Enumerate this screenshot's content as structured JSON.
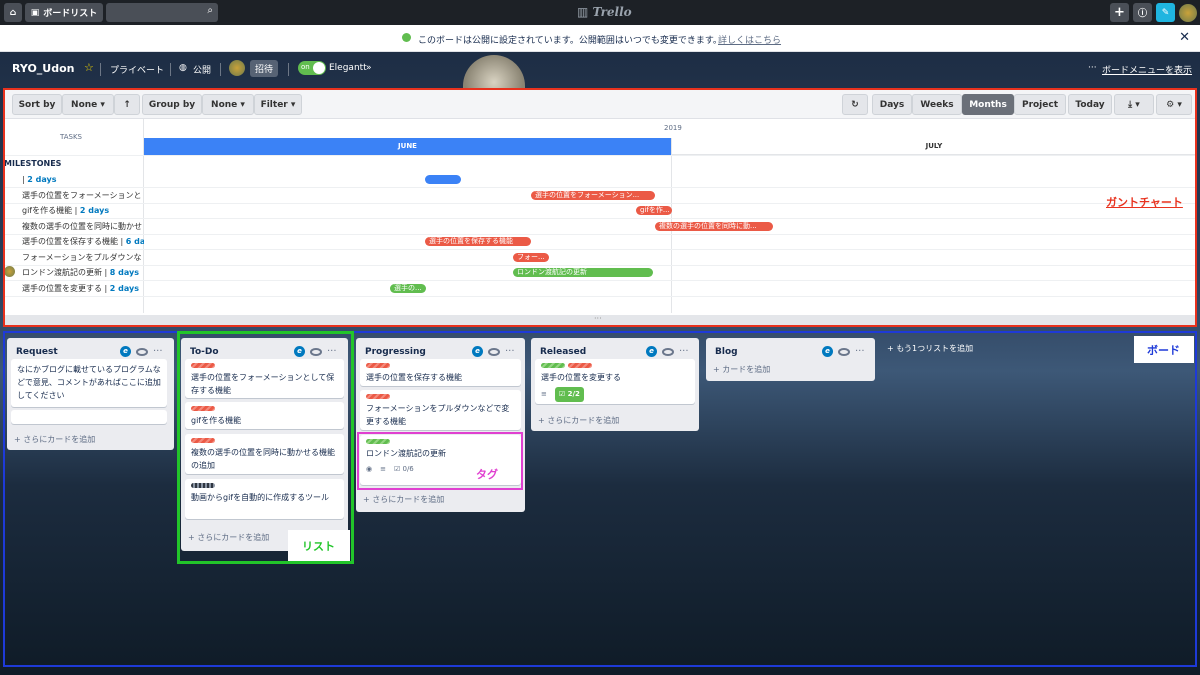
{
  "topbar": {
    "home_icon": "home-icon",
    "boards_button": "ボードリスト",
    "search_icon": "search-icon",
    "logo": "Trello",
    "add_icon": "plus-icon",
    "info_icon": "info-icon",
    "notify_icon": "bell-icon"
  },
  "banner": {
    "message": "このボードは公開に設定されています。公開範囲はいつでも変更できます。",
    "link": "詳しくはこちら",
    "close": "✕"
  },
  "board_header": {
    "title": "RYO_Udon",
    "visibility_private": "プライベート",
    "visibility_public": "公開",
    "invite": "招待",
    "toggle_label": "on",
    "powerup": "Elegantt",
    "menu": "ボードメニューを表示"
  },
  "gantt": {
    "toolbar": {
      "sort_by": "Sort by",
      "sort_none": "None",
      "group_by": "Group by",
      "group_none": "None",
      "filter": "Filter",
      "days": "Days",
      "weeks": "Weeks",
      "months": "Months",
      "project": "Project",
      "today": "Today"
    },
    "tasks_header": "TASKS",
    "year": "2019",
    "month1": "JUNE",
    "month2": "JULY",
    "milestones": "MILESTONES",
    "tasks": [
      {
        "name": "",
        "dur": "2 days"
      },
      {
        "name": "選手の位置をフォーメーションと",
        "dur": ""
      },
      {
        "name": "gifを作る機能 | ",
        "dur": "2 days"
      },
      {
        "name": "複数の選手の位置を同時に動かせ",
        "dur": ""
      },
      {
        "name": "選手の位置を保存する機能 | ",
        "dur": "6 days"
      },
      {
        "name": "フォーメーションをプルダウンな",
        "dur": ""
      },
      {
        "name": "ロンドン渡航記の更新 | ",
        "dur": "8 days"
      },
      {
        "name": "選手の位置を変更する | ",
        "dur": "2 days"
      }
    ],
    "bars": [
      {
        "label": "",
        "color": "blue"
      },
      {
        "label": "選手の位置をフォーメーション...",
        "color": "red"
      },
      {
        "label": "gifを作...",
        "color": "red"
      },
      {
        "label": "複数の選手の位置を同時に動...",
        "color": "red"
      },
      {
        "label": "選手の位置を保存する機能",
        "color": "red"
      },
      {
        "label": "フォー...",
        "color": "red"
      },
      {
        "label": "ロンドン渡航記の更新",
        "color": "green"
      },
      {
        "label": "選手の...",
        "color": "green"
      }
    ]
  },
  "lists": [
    {
      "title": "Request",
      "cards": [
        "なにかブログに載せているプログラムなどで意見、コメントがあればここに追加してください"
      ],
      "add": "+ さらにカードを追加"
    },
    {
      "title": "To-Do",
      "cards": [
        "選手の位置をフォーメーションとして保存する機能",
        "gifを作る機能",
        "複数の選手の位置を同時に動かせる機能の追加",
        "動画からgifを自動的に作成するツール"
      ],
      "add": "+ さらにカードを追加"
    },
    {
      "title": "Progressing",
      "cards": [
        "選手の位置を保存する機能",
        "フォーメーションをプルダウンなどで変更する機能",
        "ロンドン渡航記の更新"
      ],
      "add": "+ さらにカードを追加",
      "checklist": "0/6"
    },
    {
      "title": "Released",
      "cards": [
        "選手の位置を変更する"
      ],
      "add": "+ さらにカードを追加",
      "checklist": "2/2"
    },
    {
      "title": "Blog",
      "cards": [],
      "add": "+ カードを追加"
    }
  ],
  "add_list": "+ もう1つリストを追加",
  "annotations": {
    "gantt": "ガントチャート",
    "board": "ボード",
    "list": "リスト",
    "tag": "タグ"
  },
  "colors": {
    "gantt_frame": "#e8321e",
    "board_frame": "#1e3ad8",
    "list_frame": "#22c52a",
    "tag_frame": "#e040d0"
  }
}
